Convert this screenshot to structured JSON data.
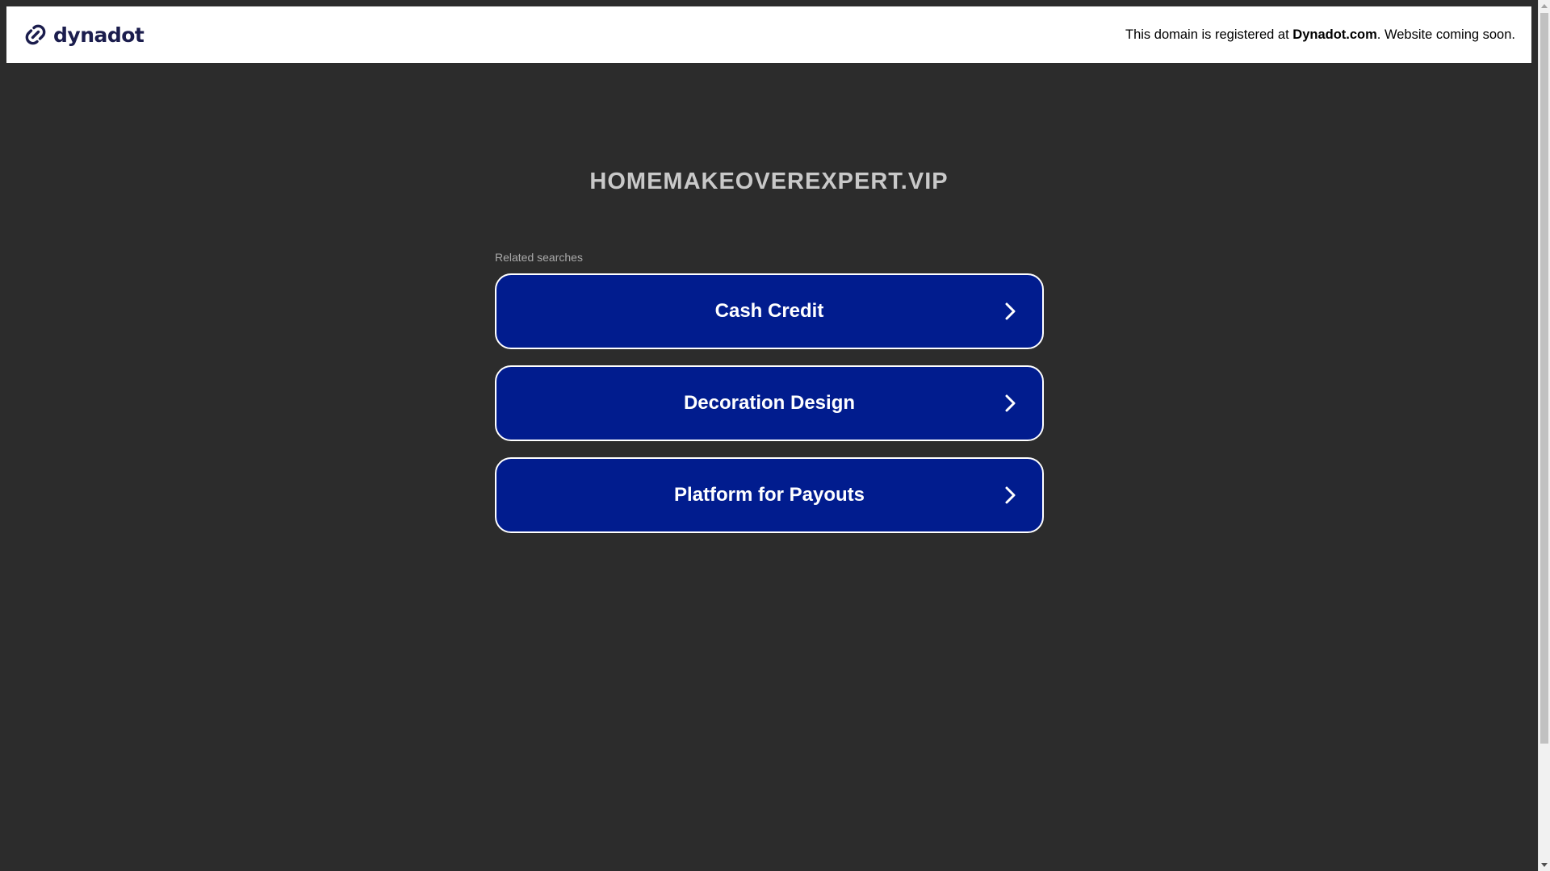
{
  "header": {
    "logo_text": "dynadot",
    "logo_icon": "dynadot-link-icon",
    "notice_prefix": "This domain is registered at ",
    "notice_brand": "Dynadot.com",
    "notice_suffix": ". Website coming soon."
  },
  "main": {
    "domain": "HOMEMAKEOVEREXPERT.VIP",
    "related_label": "Related searches",
    "links": [
      {
        "label": "Cash Credit",
        "icon": "chevron-right-icon"
      },
      {
        "label": "Decoration Design",
        "icon": "chevron-right-icon"
      },
      {
        "label": "Platform for Payouts",
        "icon": "chevron-right-icon"
      }
    ]
  },
  "colors": {
    "background": "#2c2c2c",
    "header_bg": "#ffffff",
    "brand": "#1b1d4d",
    "button_bg": "#011c8e",
    "button_border": "#ffffff",
    "domain_text": "#c9c9c9",
    "label_text": "#a9a9a9"
  }
}
